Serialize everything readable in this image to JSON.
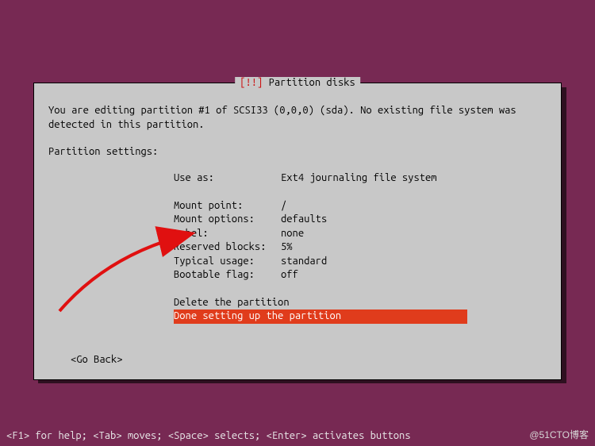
{
  "dialog": {
    "badge": "[!!]",
    "title": "Partition disks",
    "intro": "You are editing partition #1 of SCSI33 (0,0,0) (sda). No existing file system was detected in this partition.",
    "section_label": "Partition settings:",
    "settings": [
      {
        "key": "Use as:",
        "val": "Ext4 journaling file system"
      },
      {
        "key": "Mount point:",
        "val": "/"
      },
      {
        "key": "Mount options:",
        "val": "defaults"
      },
      {
        "key": "Label:",
        "val": "none"
      },
      {
        "key": "Reserved blocks:",
        "val": "5%"
      },
      {
        "key": "Typical usage:",
        "val": "standard"
      },
      {
        "key": "Bootable flag:",
        "val": "off"
      }
    ],
    "actions": {
      "delete": "Delete the partition",
      "done": "Done setting up the partition"
    },
    "go_back": "<Go Back>"
  },
  "footer": {
    "help": "<F1> for help; <Tab> moves; <Space> selects; <Enter> activates buttons",
    "watermark": "@51CTO博客"
  }
}
